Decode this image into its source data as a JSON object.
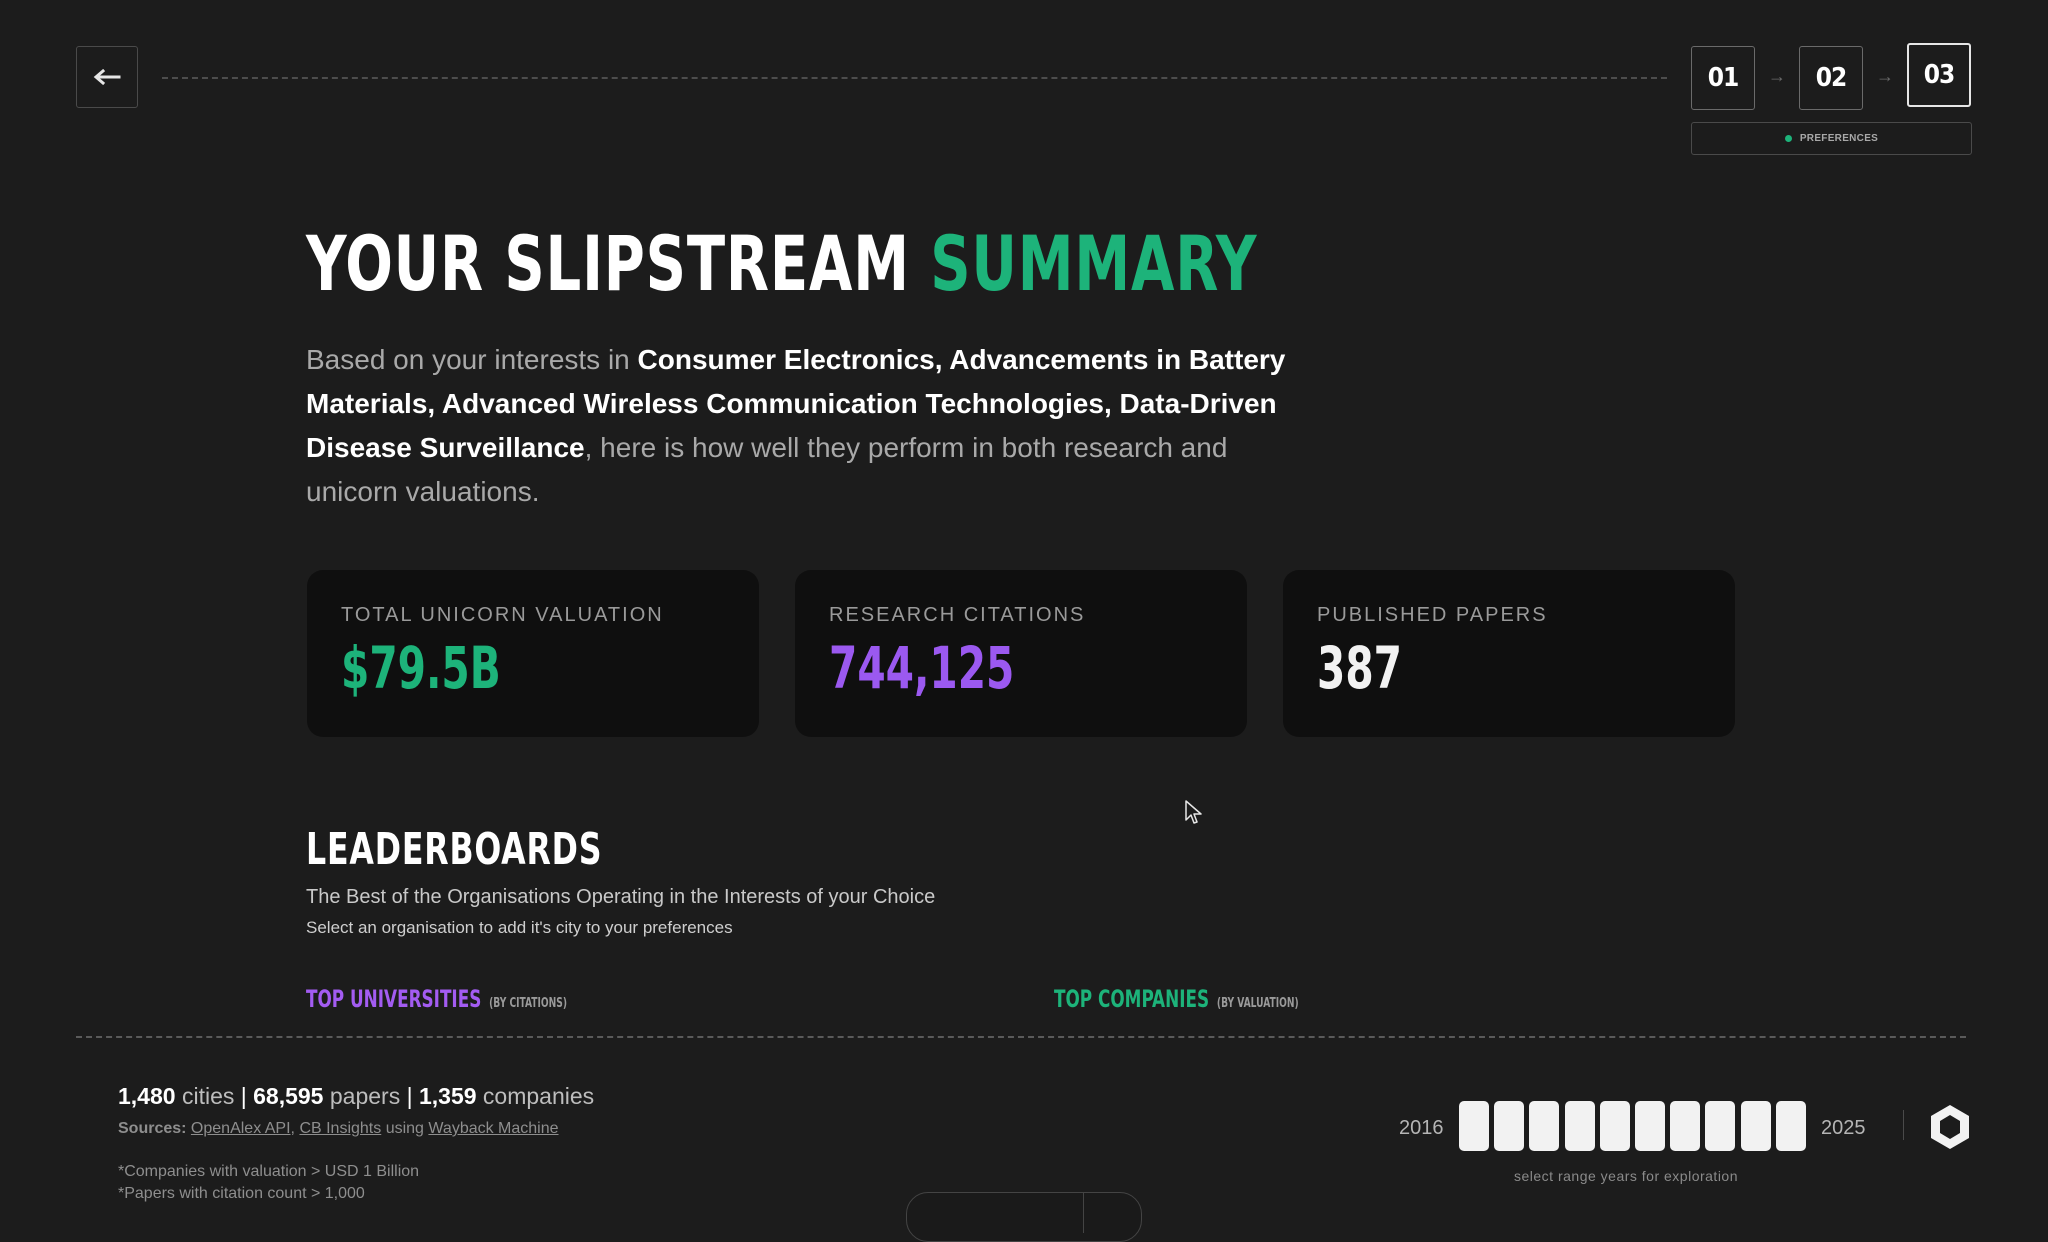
{
  "nav": {
    "steps": [
      "01",
      "02",
      "03"
    ],
    "active_step": "03",
    "badge": "PREFERENCES",
    "colors": {
      "badge_dot": "#1db37a"
    }
  },
  "header": {
    "title_main": "YOUR SLIPSTREAM",
    "title_accent": "SUMMARY",
    "intro_prefix": "Based on your interests in",
    "interests": "Consumer Electronics, Advancements in Battery Materials, Advanced Wireless Communication Technologies, Data-Driven Disease Surveillance",
    "intro_suffix": ", here is how well they perform in both research and unicorn valuations."
  },
  "stats": [
    {
      "label": "TOTAL UNICORN VALUATION",
      "value": "$79.5B",
      "color": "#1db37a"
    },
    {
      "label": "RESEARCH CITATIONS",
      "value": "744,125",
      "color": "#9b59f0"
    },
    {
      "label": "PUBLISHED PAPERS",
      "value": "387",
      "color": "#f2f2f2"
    }
  ],
  "leaderboards": {
    "title": "LEADERBOARDS",
    "subtitle": "The Best of the Organisations Operating in the Interests of your Choice",
    "hint": "Select an organisation to add it's city to your preferences",
    "universities": {
      "label": "TOP UNIVERSITIES",
      "qualifier": "(BY CITATIONS)",
      "color": "#a35cf2"
    },
    "companies": {
      "label": "TOP COMPANIES",
      "qualifier": "(BY VALUATION)",
      "color": "#1db37a"
    }
  },
  "footer": {
    "cities_count": "1,480",
    "cities_label": "cities",
    "papers_count": "68,595",
    "papers_label": "papers",
    "companies_count": "1,359",
    "companies_label": "companies",
    "sources_label": "Sources:",
    "source_1": "OpenAlex API",
    "source_2": "CB Insights",
    "using": "using",
    "source_3": "Wayback Machine",
    "note_1": "*Companies with valuation > USD 1 Billion",
    "note_2": "*Papers with citation count > 1,000",
    "year_start": "2016",
    "year_end": "2025",
    "year_blocks": 10,
    "year_hint": "select range years for exploration"
  },
  "icons": [
    "arrow-left-icon",
    "arrow-right-icon",
    "hexagon-logo-icon",
    "mouse-cursor-icon"
  ]
}
